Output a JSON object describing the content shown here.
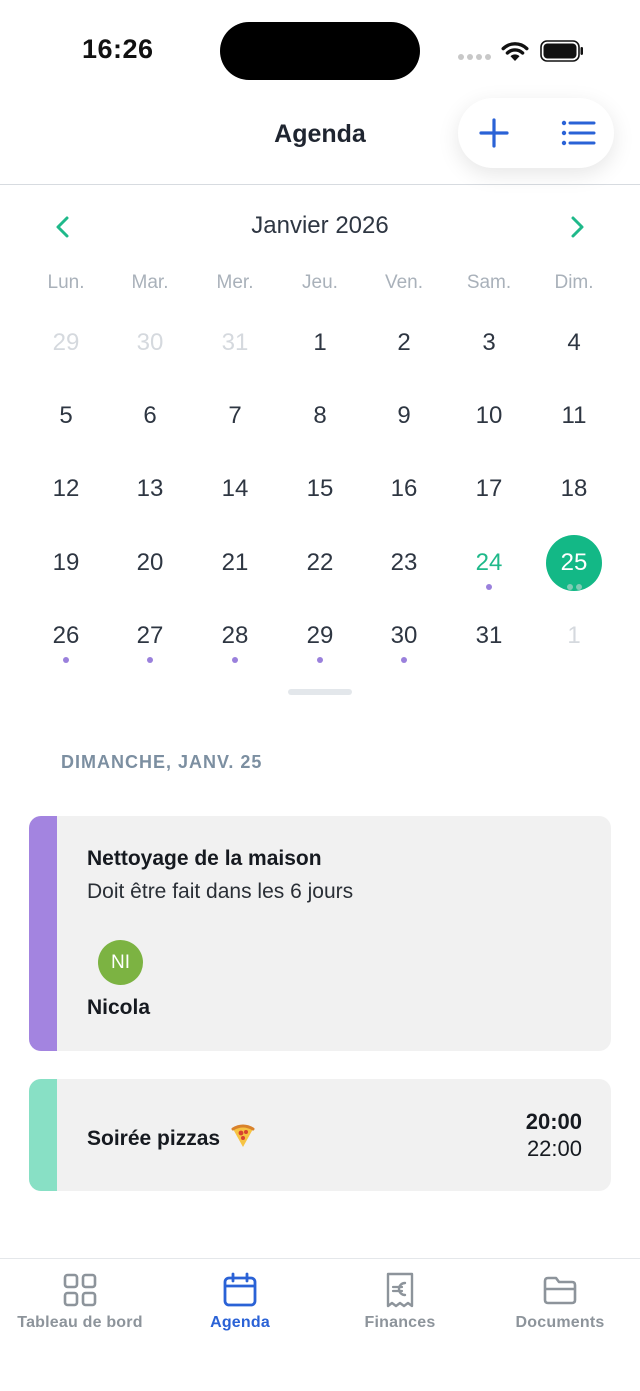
{
  "status_bar": {
    "time": "16:26"
  },
  "header": {
    "title": "Agenda",
    "add_icon": "plus-icon",
    "list_icon": "list-icon"
  },
  "calendar": {
    "month_label": "Janvier 2026",
    "weekdays": [
      "Lun.",
      "Mar.",
      "Mer.",
      "Jeu.",
      "Ven.",
      "Sam.",
      "Dim."
    ],
    "weeks": [
      [
        {
          "d": "29",
          "muted": true,
          "dots": 0
        },
        {
          "d": "30",
          "muted": true,
          "dots": 0
        },
        {
          "d": "31",
          "muted": true,
          "dots": 0
        },
        {
          "d": "1",
          "dots": 0
        },
        {
          "d": "2",
          "dots": 0
        },
        {
          "d": "3",
          "dots": 0
        },
        {
          "d": "4",
          "dots": 0
        }
      ],
      [
        {
          "d": "5",
          "dots": 0
        },
        {
          "d": "6",
          "dots": 0
        },
        {
          "d": "7",
          "dots": 0
        },
        {
          "d": "8",
          "dots": 0
        },
        {
          "d": "9",
          "dots": 0
        },
        {
          "d": "10",
          "dots": 0
        },
        {
          "d": "11",
          "dots": 0
        }
      ],
      [
        {
          "d": "12",
          "dots": 0
        },
        {
          "d": "13",
          "dots": 0
        },
        {
          "d": "14",
          "dots": 0
        },
        {
          "d": "15",
          "dots": 0
        },
        {
          "d": "16",
          "dots": 0
        },
        {
          "d": "17",
          "dots": 0
        },
        {
          "d": "18",
          "dots": 0
        }
      ],
      [
        {
          "d": "19",
          "dots": 0
        },
        {
          "d": "20",
          "dots": 0
        },
        {
          "d": "21",
          "dots": 0
        },
        {
          "d": "22",
          "dots": 0
        },
        {
          "d": "23",
          "dots": 0
        },
        {
          "d": "24",
          "today": true,
          "dots": 1
        },
        {
          "d": "25",
          "selected": true,
          "dots": 2
        }
      ],
      [
        {
          "d": "26",
          "dots": 1
        },
        {
          "d": "27",
          "dots": 1
        },
        {
          "d": "28",
          "dots": 1
        },
        {
          "d": "29",
          "dots": 1
        },
        {
          "d": "30",
          "dots": 1
        },
        {
          "d": "31",
          "dots": 0
        },
        {
          "d": "1",
          "muted": true,
          "dots": 0
        }
      ]
    ],
    "colors": {
      "selected": "#13b886",
      "today": "#1fb98a",
      "event_dot": "#9a80dc",
      "nav_arrow": "#1fb98a"
    }
  },
  "events_section": {
    "date_label": "DIMANCHE, JANV. 25",
    "events": [
      {
        "title": "Nettoyage de la maison",
        "subtitle": "Doit être fait dans les 6 jours",
        "assignee_initials": "NI",
        "assignee_name": "Nicola",
        "accent": "#a384e0"
      },
      {
        "title": "Soirée pizzas",
        "emoji_icon": "pizza-icon",
        "start": "20:00",
        "end": "22:00",
        "accent": "#88e0c5"
      }
    ]
  },
  "tabbar": {
    "tabs": [
      {
        "label": "Tableau de bord",
        "icon": "dashboard-grid-icon",
        "active": false
      },
      {
        "label": "Agenda",
        "icon": "calendar-icon",
        "active": true
      },
      {
        "label": "Finances",
        "icon": "euro-receipt-icon",
        "active": false
      },
      {
        "label": "Documents",
        "icon": "folder-icon",
        "active": false
      }
    ],
    "active_color": "#2a62d6",
    "inactive_color": "#8d949b"
  }
}
